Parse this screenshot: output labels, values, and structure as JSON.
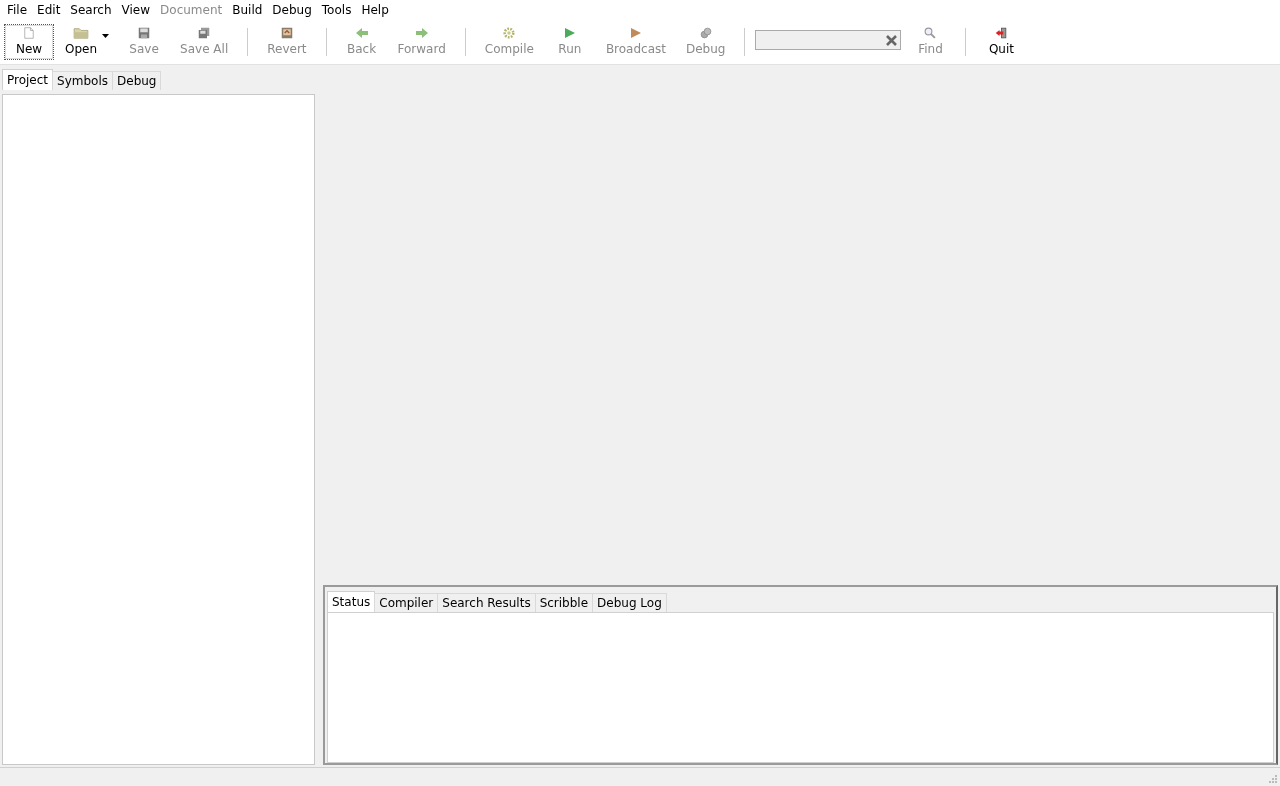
{
  "menu": [
    {
      "label": "File",
      "disabled": false
    },
    {
      "label": "Edit",
      "disabled": false
    },
    {
      "label": "Search",
      "disabled": false
    },
    {
      "label": "View",
      "disabled": false
    },
    {
      "label": "Document",
      "disabled": true
    },
    {
      "label": "Build",
      "disabled": false
    },
    {
      "label": "Debug",
      "disabled": false
    },
    {
      "label": "Tools",
      "disabled": false
    },
    {
      "label": "Help",
      "disabled": false
    }
  ],
  "toolbar": [
    {
      "kind": "button",
      "label": "New",
      "disabled": false,
      "focused": true
    },
    {
      "kind": "button",
      "label": "Open",
      "disabled": false,
      "focused": false,
      "dropdown": true
    },
    {
      "kind": "button",
      "label": "Save",
      "disabled": true,
      "focused": false
    },
    {
      "kind": "button",
      "label": "Save All",
      "disabled": true,
      "focused": false
    },
    {
      "kind": "separator"
    },
    {
      "kind": "button",
      "label": "Revert",
      "disabled": true,
      "focused": false
    },
    {
      "kind": "separator"
    },
    {
      "kind": "button",
      "label": "Back",
      "disabled": true,
      "focused": false
    },
    {
      "kind": "button",
      "label": "Forward",
      "disabled": true,
      "focused": false
    },
    {
      "kind": "separator"
    },
    {
      "kind": "button",
      "label": "Compile",
      "disabled": true,
      "focused": false
    },
    {
      "kind": "button",
      "label": "Run",
      "disabled": true,
      "focused": false
    },
    {
      "kind": "button",
      "label": "Broadcast",
      "disabled": true,
      "focused": false
    },
    {
      "kind": "button",
      "label": "Debug",
      "disabled": true,
      "focused": false
    },
    {
      "kind": "separator"
    },
    {
      "kind": "search"
    },
    {
      "kind": "button",
      "label": "Find",
      "disabled": true,
      "focused": false
    },
    {
      "kind": "separator"
    },
    {
      "kind": "button",
      "label": "Quit",
      "disabled": false,
      "focused": false
    }
  ],
  "sidebar": {
    "tabs": [
      {
        "label": "Project",
        "selected": true
      },
      {
        "label": "Symbols",
        "selected": false
      },
      {
        "label": "Debug",
        "selected": false
      }
    ]
  },
  "message_window": {
    "tabs": [
      {
        "label": "Status",
        "selected": true
      },
      {
        "label": "Compiler",
        "selected": false
      },
      {
        "label": "Search Results",
        "selected": false
      },
      {
        "label": "Scribble",
        "selected": false
      },
      {
        "label": "Debug Log",
        "selected": false
      }
    ]
  }
}
